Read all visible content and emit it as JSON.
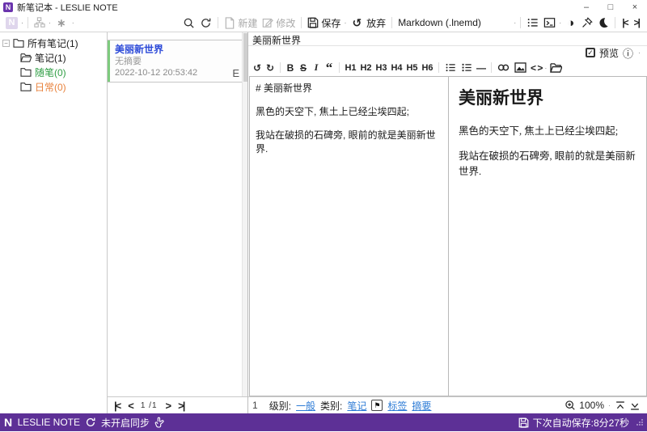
{
  "window": {
    "app_icon": "N",
    "title": "新笔记本 - LESLIE NOTE",
    "minimize": "–",
    "maximize": "□",
    "close": "×"
  },
  "toolbar": {
    "menu_logo": "N",
    "sparkle": "∗",
    "caret": "·",
    "new_label": "新建",
    "modify_label": "修改",
    "save_label": "保存",
    "discard_label": "放弃",
    "discard_glyph": "↺",
    "format_selector": "Markdown  (.lnemd)",
    "contrast_glyph": "◑",
    "collapse_left": "|<",
    "collapse_right": ">|"
  },
  "sidebar": {
    "expander": "−",
    "items": [
      {
        "label": "所有笔记(1)"
      },
      {
        "label": "笔记(1)"
      },
      {
        "label": "随笔(0)"
      },
      {
        "label": "日常(0)"
      }
    ]
  },
  "notelist": {
    "items": [
      {
        "title": "美丽新世界",
        "summary": "无摘要",
        "datetime": "2022-10-12 20:53:42",
        "badge": "E"
      }
    ],
    "nav": {
      "first": "|<",
      "prev": "<",
      "page": "1 /1",
      "next": ">",
      "last": ">|"
    }
  },
  "editor": {
    "title": "美丽新世界",
    "preview_label": "预览",
    "preview_check": "✓",
    "info_glyph": "ⓘ",
    "md_toolbar": {
      "undo": "↺",
      "redo": "↻",
      "bold": "B",
      "strikethrough": "S",
      "italic": "I",
      "quote": "“",
      "h1": "H1",
      "h2": "H2",
      "h3": "H3",
      "h4": "H4",
      "h5": "H5",
      "h6": "H6",
      "hr": "—",
      "code": "< >"
    },
    "source_lines": [
      "# 美丽新世界",
      "黑色的天空下, 焦土上已经尘埃四起;",
      "我站在破损的石碑旁, 眼前的就是美丽新世界."
    ],
    "preview": {
      "heading": "美丽新世界",
      "paragraphs": [
        "黑色的天空下, 焦土上已经尘埃四起;",
        "我站在破损的石碑旁, 眼前的就是美丽新世界."
      ]
    },
    "status": {
      "line": "1",
      "level_label": "级别:",
      "level_value": "一般",
      "category_label": "类别:",
      "category_value": "笔记",
      "flag": "⚑",
      "tags_label": "标签",
      "summary_label": "摘要",
      "zoom": "100%"
    }
  },
  "statusbar": {
    "logo": "N",
    "app_name": "LESLIE NOTE",
    "sync_status": "未开启同步",
    "autosave": "下次自动保存:8分27秒"
  },
  "colors": {
    "accent_purple": "#5d3096",
    "app_icon_purple": "#6a34ad",
    "note_title_blue": "#2b49d8",
    "link_blue": "#2e7cd6",
    "stripe_green": "#7ecb7e",
    "tree_green": "#2f9e44",
    "tree_orange": "#e8823c"
  }
}
